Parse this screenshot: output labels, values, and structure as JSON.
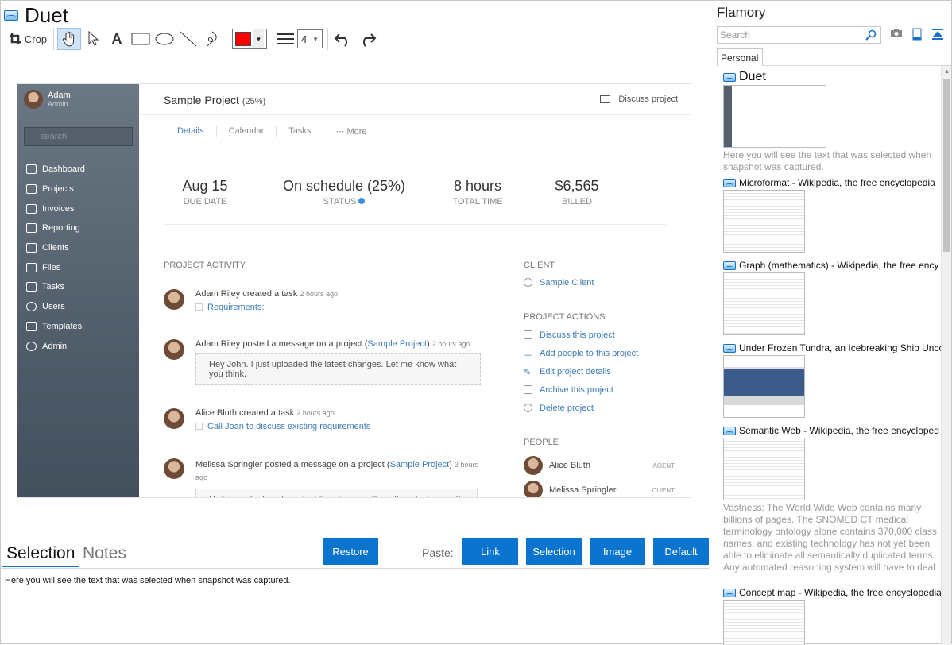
{
  "app": {
    "title": "Duet"
  },
  "toolbar": {
    "crop_label": "Crop",
    "line_width": "4",
    "color": "#ff0000"
  },
  "snapshot": {
    "user": {
      "name": "Adam",
      "role": "Admin"
    },
    "search_placeholder": "search",
    "menu": [
      "Dashboard",
      "Projects",
      "Invoices",
      "Reporting",
      "Clients",
      "Files",
      "Tasks",
      "Users",
      "Templates",
      "Admin"
    ],
    "project_title": "Sample Project",
    "project_pct": "(25%)",
    "discuss_label": "Discuss project",
    "tabs": [
      "Details",
      "Calendar",
      "Tasks",
      "⋯  More"
    ],
    "stats": [
      {
        "value": "Aug 15",
        "label": "DUE DATE"
      },
      {
        "value": "On schedule (25%)",
        "label": "STATUS"
      },
      {
        "value": "8 hours",
        "label": "TOTAL TIME"
      },
      {
        "value": "$6,565",
        "label": "BILLED"
      }
    ],
    "activity_heading": "PROJECT ACTIVITY",
    "activity": [
      {
        "who": "Adam Riley",
        "text": "created a task",
        "ago": "2 hours ago",
        "task": "Requirements:"
      },
      {
        "who": "Adam Riley",
        "text": "posted a message on a project (",
        "link": "Sample Project",
        "close": ")",
        "ago": "2 hours ago",
        "quote": "Hey John. I just uploaded the latest changes. Let me know what you think."
      },
      {
        "who": "Alice Bluth",
        "text": "created a task",
        "ago": "2 hours ago",
        "task": "Call Joan to discuss existing requirements"
      },
      {
        "who": "Melissa Springler",
        "text": "posted a message on a project (",
        "link": "Sample Project",
        "close": ")",
        "ago": "3 hours ago",
        "quote": "Hi John asked me to look at the changes. Everything looks great!"
      }
    ],
    "client_heading": "CLIENT",
    "client_name": "Sample Client",
    "actions_heading": "PROJECT ACTIONS",
    "actions": [
      "Discuss this project",
      "Add people to this project",
      "Edit project details",
      "Archive this project",
      "Delete project"
    ],
    "people_heading": "PEOPLE",
    "people": [
      {
        "name": "Alice Bluth",
        "role": "AGENT"
      },
      {
        "name": "Melissa Springler",
        "role": "CLIENT"
      }
    ]
  },
  "bottom": {
    "tabs": [
      "Selection",
      "Notes"
    ],
    "restore_label": "Restore",
    "paste_label": "Paste:",
    "paste_buttons": [
      "Link",
      "Selection",
      "Image",
      "Default"
    ],
    "selection_text": "Here you will see the text that was selected when snapshot was captured."
  },
  "flamory": {
    "title": "Flamory",
    "search_placeholder": "Search",
    "tab": "Personal",
    "entries": [
      {
        "title": "Duet",
        "note": "Here you will see the text that was selected when snapshot was captured."
      },
      {
        "title": "Microformat - Wikipedia, the free encyclopedia",
        "note": ""
      },
      {
        "title": "Graph (mathematics) - Wikipedia, the free ency",
        "note": ""
      },
      {
        "title": "Under Frozen Tundra, an Icebreaking Ship Unco",
        "note": ""
      },
      {
        "title": "Semantic Web - Wikipedia, the free encycloped",
        "note": "Vastness: The World Wide Web contains many billions of pages. The SNOMED CT medical terminology ontology alone contains 370,000 class names, and existing technology has not yet been able to eliminate all semantically duplicated terms. Any automated reasoning system will have to deal with truly huge inputs."
      },
      {
        "title": "Concept map - Wikipedia, the free encyclopedia",
        "note": ""
      }
    ]
  }
}
